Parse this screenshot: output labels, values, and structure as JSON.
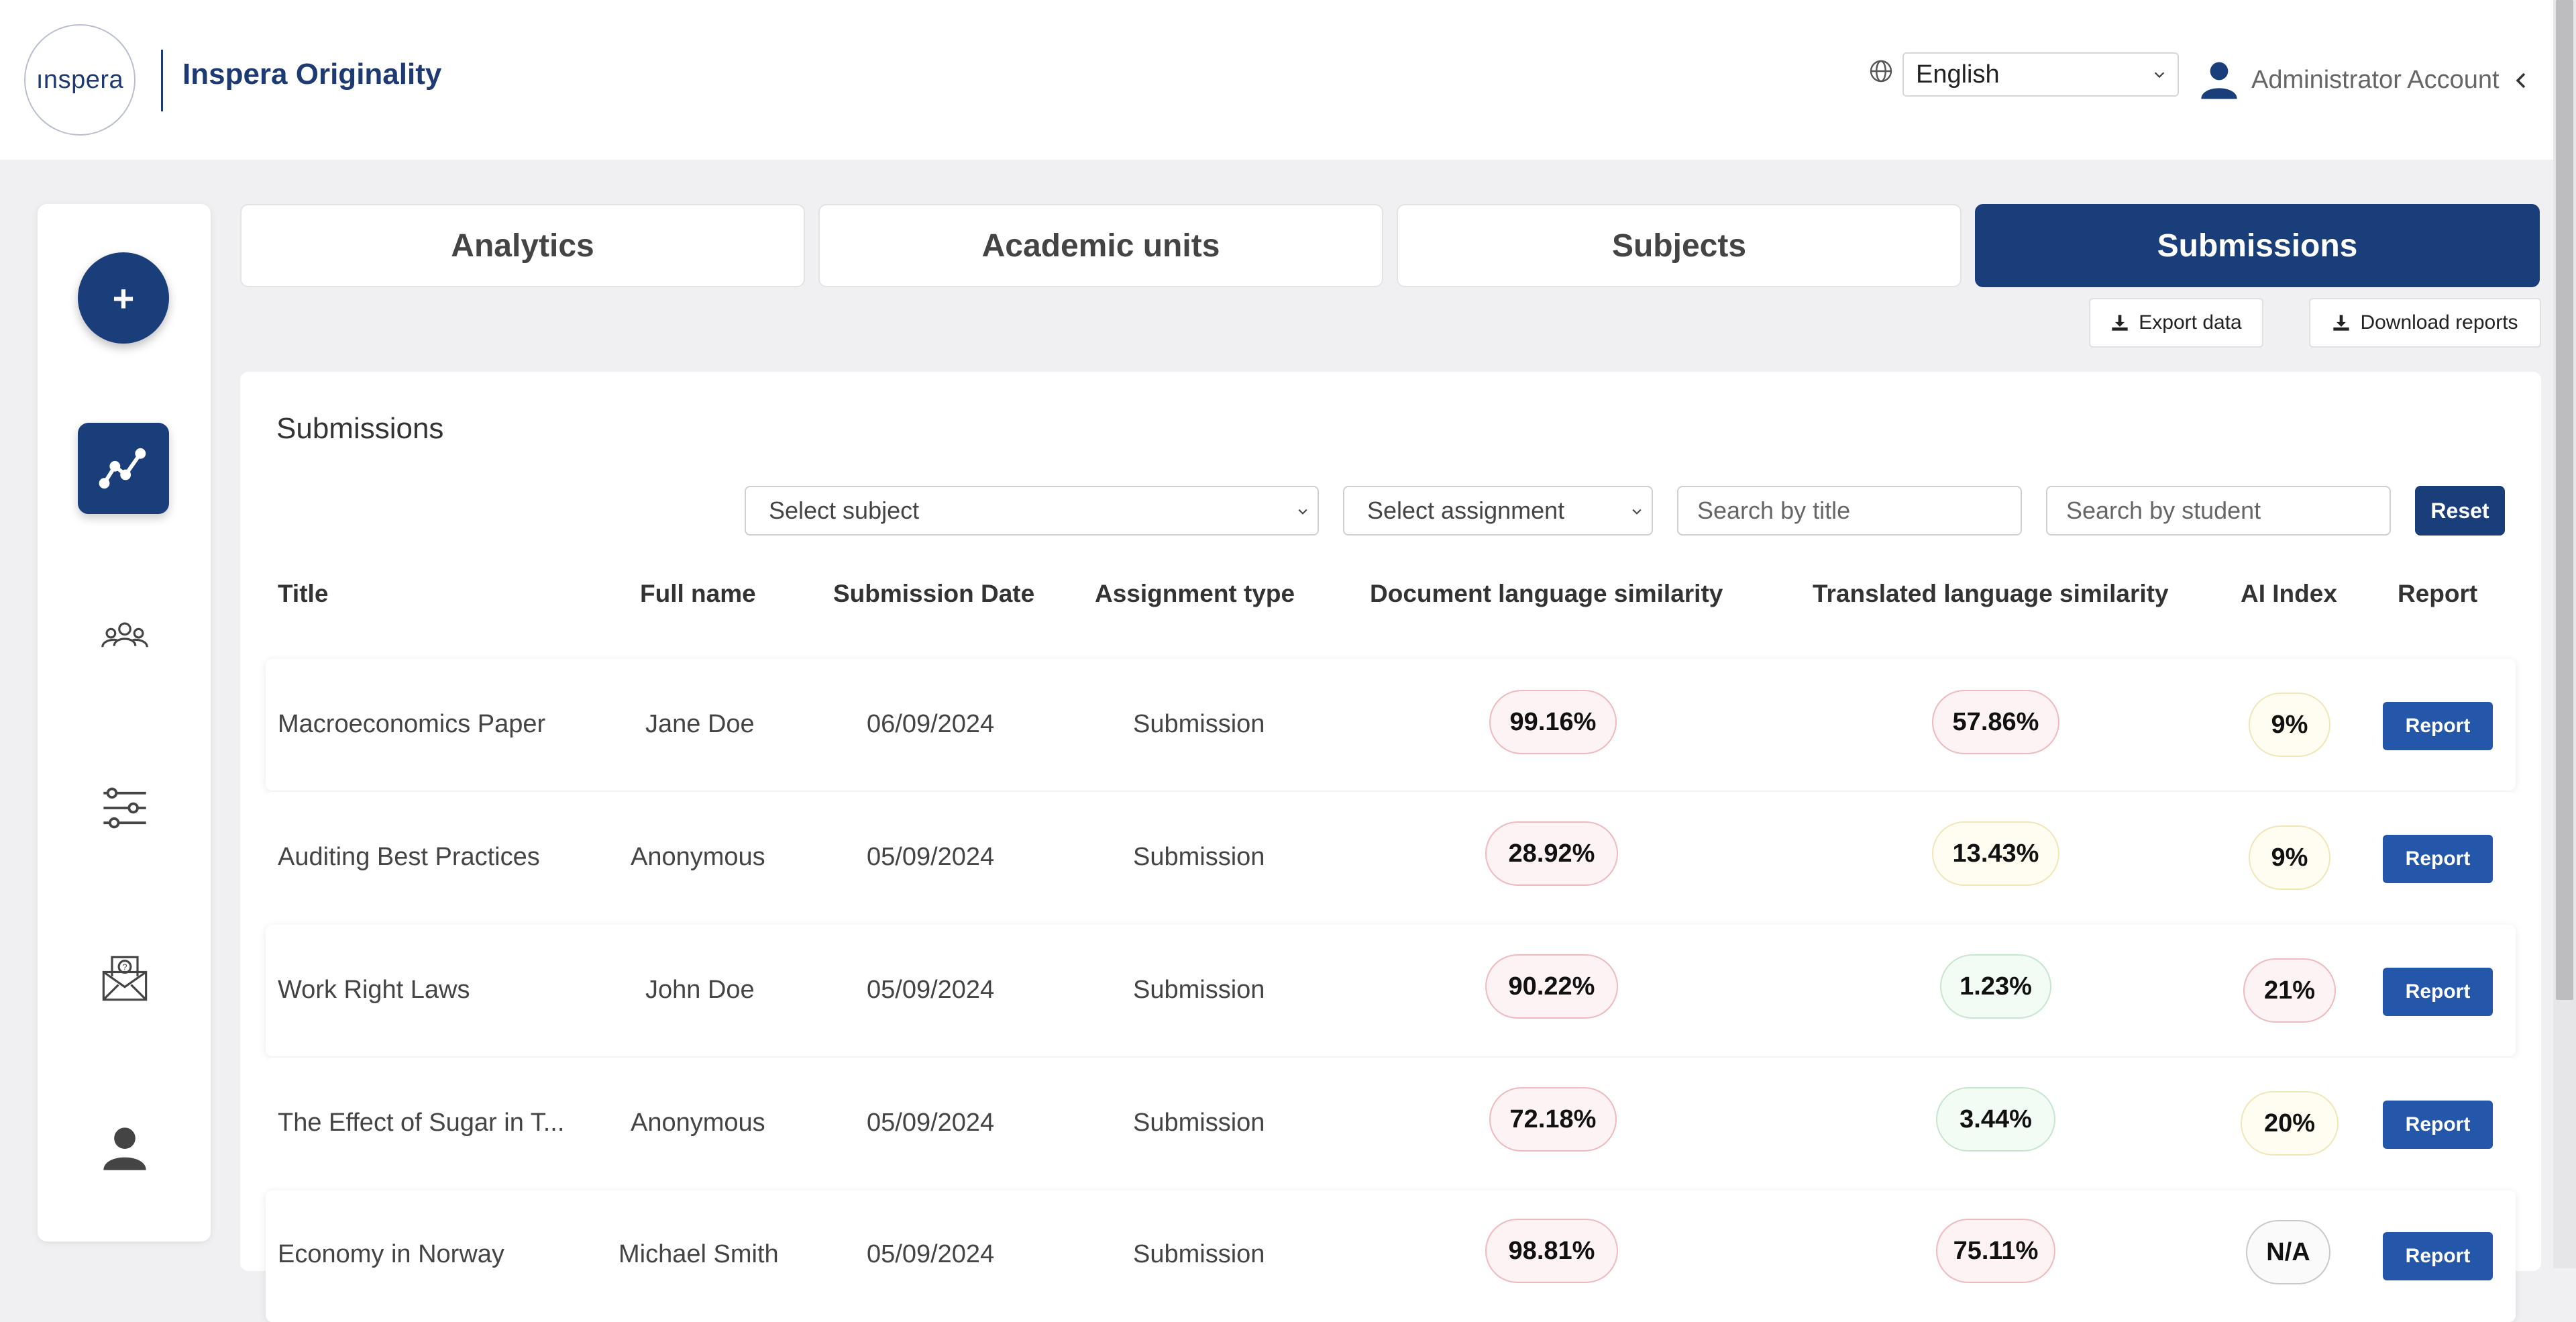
{
  "header": {
    "logo_text": "Inspera",
    "app_name": "Inspera Originality",
    "language": "English",
    "account": "Administrator Account"
  },
  "sidebar": {
    "add_label": "+",
    "items": [
      {
        "icon": "analytics-icon",
        "active": true
      },
      {
        "icon": "users-icon",
        "active": false
      },
      {
        "icon": "settings-sliders-icon",
        "active": false
      },
      {
        "icon": "help-mail-icon",
        "active": false
      },
      {
        "icon": "user-profile-icon",
        "active": false
      }
    ]
  },
  "tabs": [
    {
      "label": "Analytics",
      "active": false
    },
    {
      "label": "Academic units",
      "active": false
    },
    {
      "label": "Subjects",
      "active": false
    },
    {
      "label": "Submissions",
      "active": true
    }
  ],
  "actions": {
    "export_label": "Export data",
    "download_label": "Download reports"
  },
  "panel": {
    "title": "Submissions",
    "filters": {
      "subject_placeholder": "Select subject",
      "assignment_placeholder": "Select assignment",
      "title_placeholder": "Search by title",
      "student_placeholder": "Search by student",
      "reset_label": "Reset"
    },
    "columns": [
      "Title",
      "Full name",
      "Submission Date",
      "Assignment type",
      "Document language similarity",
      "Translated language similarity",
      "AI Index",
      "Report"
    ],
    "rows": [
      {
        "title": "Macroeconomics Paper",
        "name": "Jane Doe",
        "date": "06/09/2024",
        "type": "Submission",
        "doc_sim": "99.16%",
        "doc_level": "red",
        "trans_sim": "57.86%",
        "trans_level": "red",
        "ai": "9%",
        "ai_level": "yellow",
        "report": "Report"
      },
      {
        "title": "Auditing Best Practices",
        "name": "Anonymous",
        "date": "05/09/2024",
        "type": "Submission",
        "doc_sim": "28.92%",
        "doc_level": "red",
        "trans_sim": "13.43%",
        "trans_level": "yellow",
        "ai": "9%",
        "ai_level": "yellow",
        "report": "Report"
      },
      {
        "title": "Work Right Laws",
        "name": "John Doe",
        "date": "05/09/2024",
        "type": "Submission",
        "doc_sim": "90.22%",
        "doc_level": "red",
        "trans_sim": "1.23%",
        "trans_level": "green",
        "ai": "21%",
        "ai_level": "red",
        "report": "Report"
      },
      {
        "title": "The Effect of Sugar in T...",
        "name": "Anonymous",
        "date": "05/09/2024",
        "type": "Submission",
        "doc_sim": "72.18%",
        "doc_level": "red",
        "trans_sim": "3.44%",
        "trans_level": "green",
        "ai": "20%",
        "ai_level": "yellow",
        "report": "Report"
      },
      {
        "title": "Economy in Norway",
        "name": "Michael Smith",
        "date": "05/09/2024",
        "type": "Submission",
        "doc_sim": "98.81%",
        "doc_level": "red",
        "trans_sim": "75.11%",
        "trans_level": "red",
        "ai": "N/A",
        "ai_level": "gray",
        "report": "Report"
      }
    ]
  },
  "colors": {
    "primary": "#1a3e7a",
    "report_button": "#2456a9",
    "level_red": "#f0b9bd",
    "level_yellow": "#f1e6b8",
    "level_green": "#c6e6cd"
  }
}
